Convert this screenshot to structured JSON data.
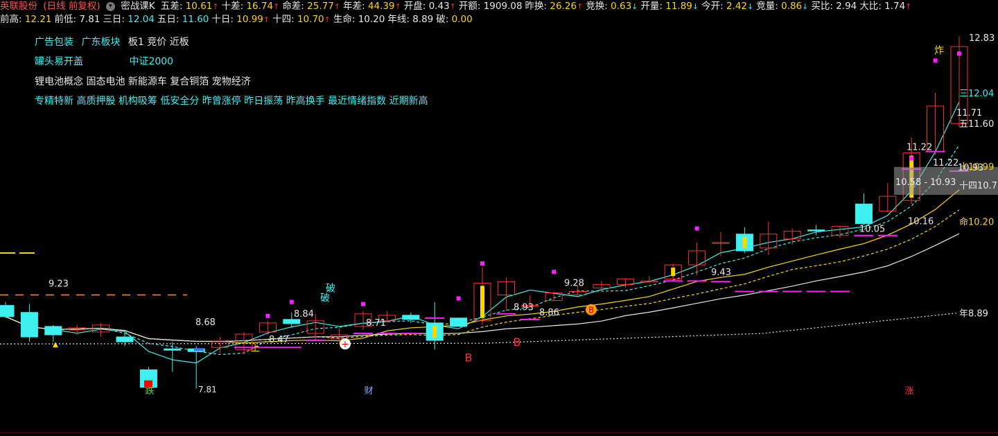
{
  "header": {
    "stock_title": "英联股份",
    "period_label": "(日线 前复权)",
    "chevron_icon": "chevron-down-icon",
    "indicator_name": "密战课K",
    "row1": [
      {
        "k": "五差",
        "v": "10.61",
        "c": "#ffd700",
        "a": "up"
      },
      {
        "k": "十差",
        "v": "16.74",
        "c": "#ffd700",
        "a": "up"
      },
      {
        "k": "命差",
        "v": "25.77",
        "c": "#ffd700",
        "a": "up"
      },
      {
        "k": "年差",
        "v": "44.39",
        "c": "#ffd700",
        "a": "up"
      },
      {
        "k": "开盘",
        "v": "0.43",
        "c": "#e8e8e8",
        "a": "up"
      },
      {
        "k": "开额",
        "v": "1909.08",
        "c": "#e8e8e8",
        "a": ""
      },
      {
        "k": "昨换",
        "v": "26.26",
        "c": "#ffd700",
        "a": "up"
      },
      {
        "k": "竞换",
        "v": "0.63",
        "c": "#ffd700",
        "a": "down"
      },
      {
        "k": "开量",
        "v": "11.89",
        "c": "#ffd700",
        "a": "down"
      },
      {
        "k": "今开",
        "v": "2.42",
        "c": "#ffd700",
        "a": "down"
      },
      {
        "k": "竞量",
        "v": "0.86",
        "c": "#ffd700",
        "a": "down"
      },
      {
        "k": "买比",
        "v": "2.94",
        "c": "#e8e8e8",
        "a": ""
      },
      {
        "k": "大比",
        "v": "1.74",
        "c": "#e8e8e8",
        "a": "up"
      }
    ],
    "row2": [
      {
        "k": "前高",
        "v": "12.21",
        "c": "#ffd700",
        "a": ""
      },
      {
        "k": "前低",
        "v": "7.81",
        "c": "#e8e8e8",
        "a": ""
      },
      {
        "k": "三日",
        "v": "12.04",
        "c": "#3ff0f0",
        "a": ""
      },
      {
        "k": "五日",
        "v": "11.60",
        "c": "#3ff0f0",
        "a": ""
      },
      {
        "k": "十日",
        "v": "10.99",
        "c": "#ffd700",
        "a": "up"
      },
      {
        "k": "十四",
        "v": "10.70",
        "c": "#ffd700",
        "a": "up"
      },
      {
        "k": "生命",
        "v": "10.20",
        "c": "#e8e8e8",
        "a": ""
      },
      {
        "k": "年线",
        "v": "8.89",
        "c": "#e8e8e8",
        "a": ""
      },
      {
        "k": "破",
        "v": "0.00",
        "c": "#ffd700",
        "a": ""
      }
    ]
  },
  "tags": {
    "line1": [
      "广告包装",
      "广东板块"
    ],
    "line1_extra": "板1 竞价 近板",
    "line2a": "罐头易开盖",
    "line2b": "中证2000",
    "line3": "锂电池概念 固态电池 新能源车 复合铜箔 宠物经济",
    "line4": "专精特新 高质押股 机构吸筹 低安全分 昨曾涨停 昨日振荡 昨高换手 最近情绪指数 近期新高"
  },
  "colors": {
    "up": "#ff3030",
    "down": "#3ff0f0",
    "yellow": "#ffd700",
    "white": "#e8e8e8",
    "magenta": "#ff20ff",
    "cyan": "#3ff0f0",
    "orange": "#ff9a00"
  },
  "chart_data": {
    "type": "candlestick",
    "y_range": [
      7.55,
      12.9
    ],
    "candles": [
      {
        "o": 9.0,
        "h": 9.05,
        "l": 8.82,
        "c": 8.84
      },
      {
        "o": 8.9,
        "h": 9.02,
        "l": 8.48,
        "c": 8.55
      },
      {
        "o": 8.7,
        "h": 8.72,
        "l": 8.48,
        "c": 8.58
      },
      {
        "o": 8.65,
        "h": 8.72,
        "l": 8.58,
        "c": 8.68
      },
      {
        "o": 8.62,
        "h": 8.75,
        "l": 8.55,
        "c": 8.72
      },
      {
        "o": 8.55,
        "h": 8.6,
        "l": 8.42,
        "c": 8.48
      },
      {
        "o": 8.08,
        "h": 8.12,
        "l": 7.83,
        "c": 7.83
      },
      {
        "o": 8.38,
        "h": 8.48,
        "l": 8.05,
        "c": 8.36
      },
      {
        "o": 8.38,
        "h": 8.42,
        "l": 7.81,
        "c": 8.34
      },
      {
        "o": 8.4,
        "h": 8.55,
        "l": 8.32,
        "c": 8.48
      },
      {
        "o": 8.37,
        "h": 8.62,
        "l": 8.3,
        "c": 8.59
      },
      {
        "o": 8.62,
        "h": 8.78,
        "l": 8.58,
        "c": 8.75
      },
      {
        "o": 8.8,
        "h": 8.9,
        "l": 8.68,
        "c": 8.74
      },
      {
        "o": 8.6,
        "h": 8.88,
        "l": 8.5,
        "c": 8.78
      },
      {
        "o": 8.52,
        "h": 8.68,
        "l": 8.45,
        "c": 8.58
      },
      {
        "o": 8.7,
        "h": 8.92,
        "l": 8.65,
        "c": 8.88
      },
      {
        "o": 8.78,
        "h": 8.92,
        "l": 8.75,
        "c": 8.86
      },
      {
        "o": 8.86,
        "h": 8.9,
        "l": 8.75,
        "c": 8.8
      },
      {
        "o": 8.75,
        "h": 9.05,
        "l": 8.37,
        "c": 8.5
      },
      {
        "o": 8.82,
        "h": 8.82,
        "l": 8.7,
        "c": 8.7
      },
      {
        "o": 8.78,
        "h": 9.55,
        "l": 8.72,
        "c": 9.32
      },
      {
        "o": 9.15,
        "h": 9.4,
        "l": 8.92,
        "c": 9.34
      },
      {
        "o": 9.0,
        "h": 9.15,
        "l": 8.95,
        "c": 9.0
      },
      {
        "o": 9.07,
        "h": 9.2,
        "l": 9.07,
        "c": 9.18
      },
      {
        "o": 9.15,
        "h": 9.28,
        "l": 9.15,
        "c": 9.2
      },
      {
        "o": 9.25,
        "h": 9.35,
        "l": 9.2,
        "c": 9.3
      },
      {
        "o": 9.3,
        "h": 9.39,
        "l": 9.25,
        "c": 9.38
      },
      {
        "o": 9.35,
        "h": 9.42,
        "l": 9.33,
        "c": 9.35
      },
      {
        "o": 9.38,
        "h": 9.6,
        "l": 9.35,
        "c": 9.58
      },
      {
        "o": 9.58,
        "h": 9.9,
        "l": 9.43,
        "c": 9.78
      },
      {
        "o": 9.9,
        "h": 10.05,
        "l": 9.7,
        "c": 9.9
      },
      {
        "o": 10.02,
        "h": 10.12,
        "l": 9.75,
        "c": 9.78
      },
      {
        "o": 9.82,
        "h": 10.2,
        "l": 9.72,
        "c": 10.02
      },
      {
        "o": 9.95,
        "h": 10.1,
        "l": 9.87,
        "c": 10.06
      },
      {
        "o": 10.08,
        "h": 10.15,
        "l": 10.0,
        "c": 10.07
      },
      {
        "o": 10.0,
        "h": 10.13,
        "l": 9.97,
        "c": 10.13
      },
      {
        "o": 10.45,
        "h": 10.6,
        "l": 10.15,
        "c": 10.17
      },
      {
        "o": 10.35,
        "h": 10.75,
        "l": 10.34,
        "c": 10.56
      },
      {
        "o": 10.5,
        "h": 11.4,
        "l": 10.45,
        "c": 11.18
      },
      {
        "o": 11.2,
        "h": 12.04,
        "l": 11.15,
        "c": 11.85
      },
      {
        "o": 11.6,
        "h": 12.85,
        "l": 11.55,
        "c": 12.7
      }
    ],
    "bars": [
      {
        "i": 38,
        "top": 11.45,
        "bot": 11.22,
        "fill": "#ffd700"
      },
      {
        "i": 39,
        "top": 12.7,
        "bot": 11.2,
        "fill": "none"
      }
    ],
    "labels": [
      {
        "t": "9.23",
        "c": "#e8e8e8"
      },
      {
        "t": "8.68",
        "c": "#e8e8e8"
      },
      {
        "t": "8.84",
        "c": "#e8e8e8"
      },
      {
        "t": "8.71",
        "c": "#e8e8e8"
      },
      {
        "t": "8.47",
        "c": "#e8e8e8"
      },
      {
        "t": "9.28",
        "c": "#e8e8e8"
      },
      {
        "t": "8.93",
        "c": "#e8e8e8"
      },
      {
        "t": "8.86",
        "c": "#e8e8e8"
      },
      {
        "t": "9.43",
        "c": "#e8e8e8"
      },
      {
        "t": "10.05",
        "c": "#e8e8e8"
      },
      {
        "t": "10.16",
        "c": "#e8e8e8"
      },
      {
        "t": "11.22",
        "c": "#e8e8e8"
      },
      {
        "t": "11.71",
        "c": "#e8e8e8"
      },
      {
        "t": "10.58 - 10.93",
        "c": "#e8e8e8"
      },
      {
        "t": "10.93",
        "c": "#e8e8e8"
      },
      {
        "t": "12.83",
        "c": "#e8e8e8"
      }
    ],
    "right_labels": [
      {
        "t": "三12.04",
        "c": "#3ff0f0"
      },
      {
        "t": "五11.60",
        "c": "#e8e8e8"
      },
      {
        "t": "十10.99",
        "c": "#ffd700"
      },
      {
        "t": "十四10.7",
        "c": "#e8e8e8"
      },
      {
        "t": "命10.20",
        "c": "#ffd700"
      },
      {
        "t": "年8.89",
        "c": "#e8e8e8"
      },
      {
        "t": "11.71",
        "c": "#e8e8e8"
      },
      {
        "t": "11.22",
        "c": "#e8e8e8"
      },
      {
        "t": "12.83",
        "c": "#e8e8e8"
      }
    ],
    "markers": {
      "po": "破",
      "zha": "炸",
      "die": "跌",
      "cai": "财",
      "zhang": "涨",
      "shang": "上",
      "buy_b": "B",
      "low_label": "7.81",
      "low_label2": "7.81",
      "circle_b": "B"
    }
  }
}
